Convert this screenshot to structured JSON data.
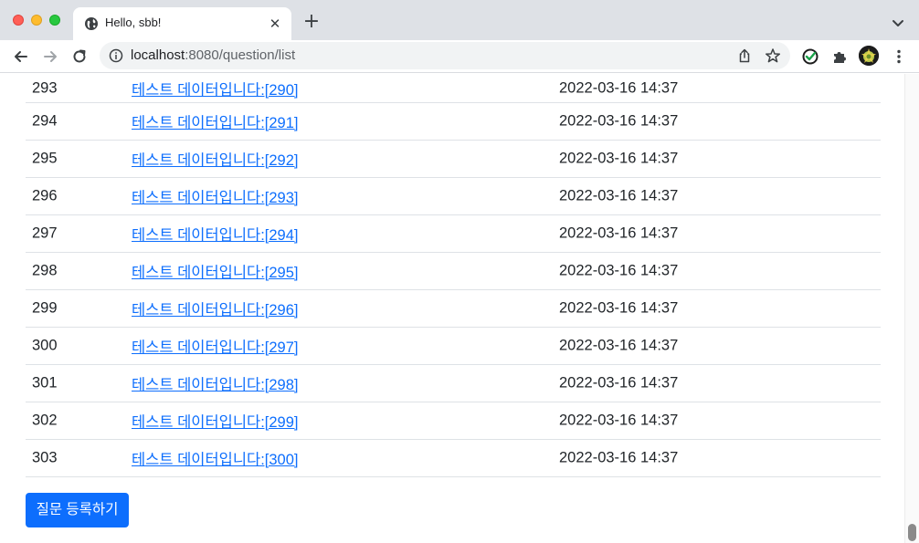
{
  "browser": {
    "tab_title": "Hello, sbb!",
    "url_host": "localhost",
    "url_rest": ":8080/question/list",
    "icons": {
      "tab_favicon": "globe-icon",
      "tab_close": "close-icon",
      "new_tab": "plus-icon",
      "tab_search": "chevron-down-icon",
      "back": "arrow-left-icon",
      "forward": "arrow-right-icon",
      "reload": "reload-icon",
      "site_info": "info-icon",
      "share": "share-icon",
      "bookmark": "star-icon",
      "extension_check": "check-circle-icon",
      "extensions": "puzzle-icon",
      "profile": "avatar",
      "menu": "kebab-menu-icon"
    }
  },
  "questions": [
    {
      "num": "293",
      "subject": "테스트 데이터입니다:[290]",
      "date": "2022-03-16 14:37"
    },
    {
      "num": "294",
      "subject": "테스트 데이터입니다:[291]",
      "date": "2022-03-16 14:37"
    },
    {
      "num": "295",
      "subject": "테스트 데이터입니다:[292]",
      "date": "2022-03-16 14:37"
    },
    {
      "num": "296",
      "subject": "테스트 데이터입니다:[293]",
      "date": "2022-03-16 14:37"
    },
    {
      "num": "297",
      "subject": "테스트 데이터입니다:[294]",
      "date": "2022-03-16 14:37"
    },
    {
      "num": "298",
      "subject": "테스트 데이터입니다:[295]",
      "date": "2022-03-16 14:37"
    },
    {
      "num": "299",
      "subject": "테스트 데이터입니다:[296]",
      "date": "2022-03-16 14:37"
    },
    {
      "num": "300",
      "subject": "테스트 데이터입니다:[297]",
      "date": "2022-03-16 14:37"
    },
    {
      "num": "301",
      "subject": "테스트 데이터입니다:[298]",
      "date": "2022-03-16 14:37"
    },
    {
      "num": "302",
      "subject": "테스트 데이터입니다:[299]",
      "date": "2022-03-16 14:37"
    },
    {
      "num": "303",
      "subject": "테스트 데이터입니다:[300]",
      "date": "2022-03-16 14:37"
    }
  ],
  "create_button_label": "질문 등록하기",
  "colors": {
    "link": "#0d6efd",
    "button_bg": "#0d6efd",
    "tab_strip": "#dee1e6",
    "row_border": "#dee2e6"
  }
}
